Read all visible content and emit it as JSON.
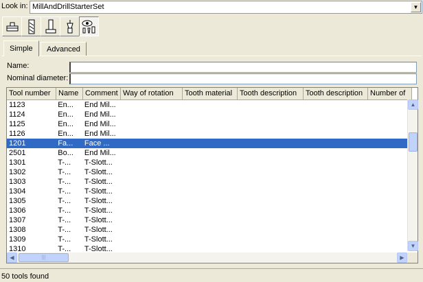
{
  "look_in": {
    "label": "Look in:",
    "value": "MillAndDrillStarterSet"
  },
  "toolbar": {
    "buttons": [
      {
        "icon": "mill-holder-icon"
      },
      {
        "icon": "drill-tool-icon"
      },
      {
        "icon": "tool-assembly-icon"
      },
      {
        "icon": "insert-tool-icon"
      },
      {
        "icon": "view-tools-icon",
        "active": true
      }
    ]
  },
  "tabs": [
    {
      "label": "Simple",
      "selected": true
    },
    {
      "label": "Advanced",
      "selected": false
    }
  ],
  "form": {
    "name_label": "Name:",
    "name_value": "",
    "diameter_label": "Nominal diameter:",
    "diameter_value": ""
  },
  "table": {
    "columns": [
      "Tool number",
      "Name",
      "Comment",
      "Way of rotation",
      "Tooth material",
      "Tooth description",
      "Tooth description",
      "Number of"
    ],
    "rows": [
      [
        "1123",
        "En...",
        "End Mil..."
      ],
      [
        "1124",
        "En...",
        "End Mil..."
      ],
      [
        "1125",
        "En...",
        "End Mil..."
      ],
      [
        "1126",
        "En...",
        "End Mil..."
      ],
      [
        "1201",
        "Fa...",
        "Face ..."
      ],
      [
        "2501",
        "Bo...",
        "End Mil..."
      ],
      [
        "1301",
        "T-...",
        "T-Slott..."
      ],
      [
        "1302",
        "T-...",
        "T-Slott..."
      ],
      [
        "1303",
        "T-...",
        "T-Slott..."
      ],
      [
        "1304",
        "T-...",
        "T-Slott..."
      ],
      [
        "1305",
        "T-...",
        "T-Slott..."
      ],
      [
        "1306",
        "T-...",
        "T-Slott..."
      ],
      [
        "1307",
        "T-...",
        "T-Slott..."
      ],
      [
        "1308",
        "T-...",
        "T-Slott..."
      ],
      [
        "1309",
        "T-...",
        "T-Slott..."
      ],
      [
        "1310",
        "T-...",
        "T-Slott..."
      ]
    ],
    "selected_row": 4
  },
  "status": {
    "text": "50 tools found"
  },
  "colors": {
    "selection": "#316ac5",
    "background": "#ece9d8"
  }
}
